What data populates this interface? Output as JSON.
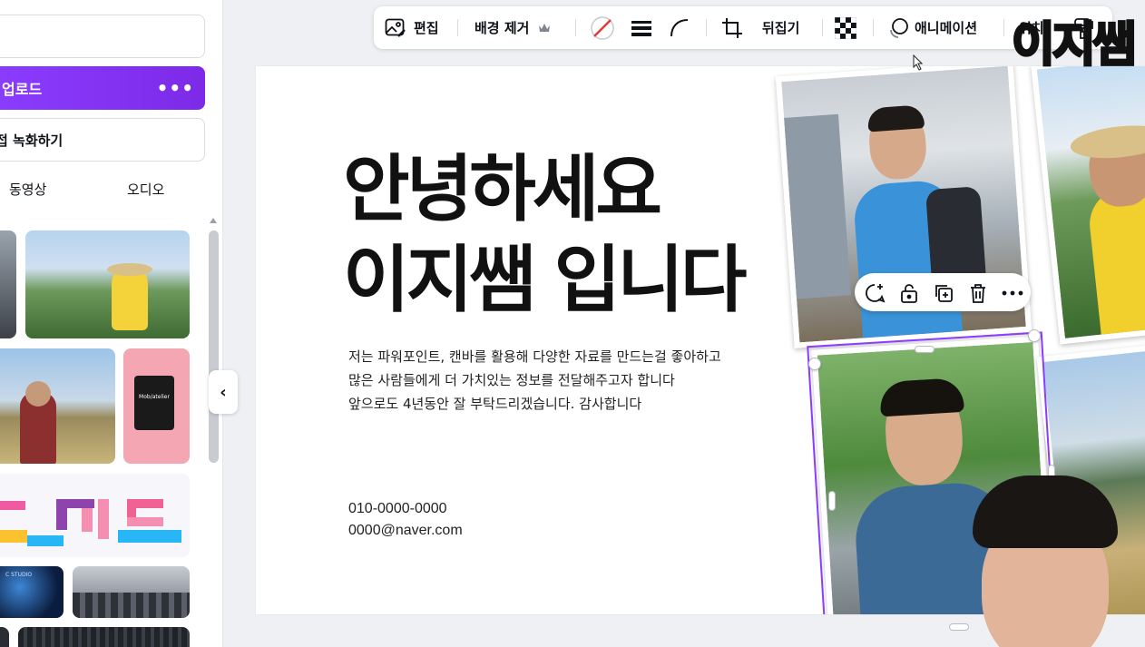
{
  "left_panel": {
    "search_placeholder": "",
    "upload_label": "업로드",
    "upload_more": "•••",
    "record_label": "접 녹화하기",
    "tabs": [
      "동영상",
      "오디오"
    ],
    "collapse_glyph": "‹",
    "thumb_bag_text": "Mob/atelier",
    "thumb_space_text": "C STUDIO"
  },
  "toolbar": {
    "edit_label": "편집",
    "remove_bg_label": "배경 제거",
    "flip_label": "뒤집기",
    "animate_label": "애니메이션",
    "position_label": "위치",
    "icons": [
      "image-edit-icon",
      "crown-icon",
      "border-color-icon",
      "border-style-icon",
      "corner-rounding-icon",
      "crop-icon",
      "transparency-icon",
      "animate-icon",
      "paint-roller-icon"
    ]
  },
  "slide": {
    "heading_line1": "안녕하세요",
    "heading_line2": "이지쌤 입니다",
    "body_lines": [
      "저는 파워포인트, 캔바를 활용해 다양한 자료를 만드는걸 좋아하고",
      "많은 사람들에게 더 가치있는 정보를 전달해주고자 합니다",
      "앞으로도 4년동안 잘 부탁드리겠습니다. 감사합니다"
    ],
    "phone": "010-0000-0000",
    "email": "0000@naver.com"
  },
  "float_menu": {
    "icons": [
      "comment-add-icon",
      "lock-icon",
      "duplicate-icon",
      "trash-icon",
      "more-icon"
    ]
  },
  "watermark": "이지쌤",
  "colors": {
    "accent": "#8b3dff",
    "upload_gradient_end": "#7d2ae8",
    "canvas_bg": "#eef0f3"
  }
}
